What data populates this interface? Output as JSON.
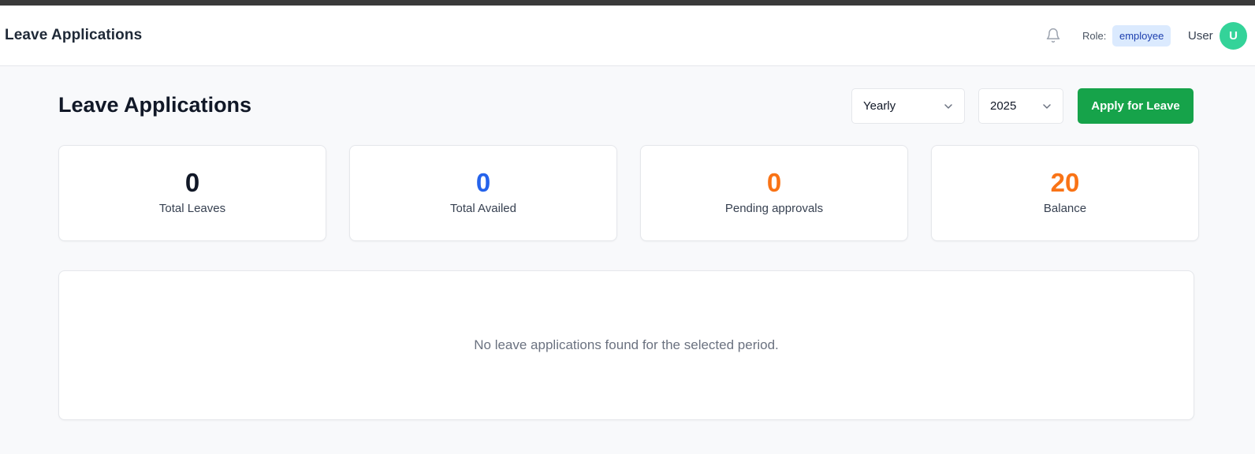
{
  "header": {
    "app_title": "Leave Applications",
    "notification_icon": "bell-icon",
    "role_label": "Role:",
    "role_value": "employee",
    "user_name": "User",
    "avatar_initial": "U"
  },
  "main": {
    "title": "Leave Applications",
    "period_select": {
      "selected": "Yearly"
    },
    "year_select": {
      "selected": "2025"
    },
    "apply_button_label": "Apply for Leave"
  },
  "stats": [
    {
      "value": "0",
      "label": "Total Leaves",
      "color": "#111827"
    },
    {
      "value": "0",
      "label": "Total Availed",
      "color": "#2563eb"
    },
    {
      "value": "0",
      "label": "Pending approvals",
      "color": "#f97316"
    },
    {
      "value": "20",
      "label": "Balance",
      "color": "#f97316"
    }
  ],
  "empty_state": {
    "message": "No leave applications found for the selected period."
  },
  "colors": {
    "accent_green": "#16a34a",
    "badge_bg": "#dbeafe",
    "avatar_bg": "#34d399"
  }
}
